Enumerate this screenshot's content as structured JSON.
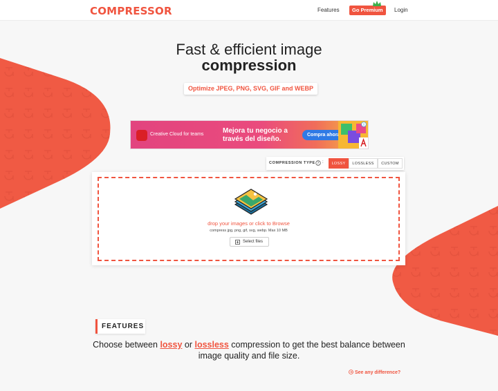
{
  "header": {
    "logo": "COMPRESSOR",
    "nav_features": "Features",
    "nav_premium": "Go Premium",
    "nav_login": "Login"
  },
  "hero": {
    "line1": "Fast & efficient image",
    "line2": "compression",
    "subtitle": "Optimize JPEG, PNG, SVG, GIF and WEBP"
  },
  "ad": {
    "brand_text": "Creative Cloud for teams",
    "headline": "Mejora tu negocio a través del diseño.",
    "cta": "Compra ahora"
  },
  "compression": {
    "label": "COMPRESSION TYPE",
    "separator": ":",
    "options": [
      "LOSSY",
      "LOSSLESS",
      "CUSTOM"
    ],
    "selected": "LOSSY"
  },
  "upload": {
    "drop_text": "drop your images or click to Browse",
    "sub_text": "compress jpg, png, gif, svg, webp. Max 10 MB",
    "select_label": "Select files"
  },
  "features": {
    "heading": "FEATURES",
    "text_before": "Choose between ",
    "lossy_link": "lossy",
    "text_or": " or ",
    "lossless_link": "lossless",
    "text_after": " compression to get the best balance between image quality and file size.",
    "see_difference": "See any difference?"
  },
  "colors": {
    "brand": "#f0543f",
    "background": "#f7f7f7"
  }
}
